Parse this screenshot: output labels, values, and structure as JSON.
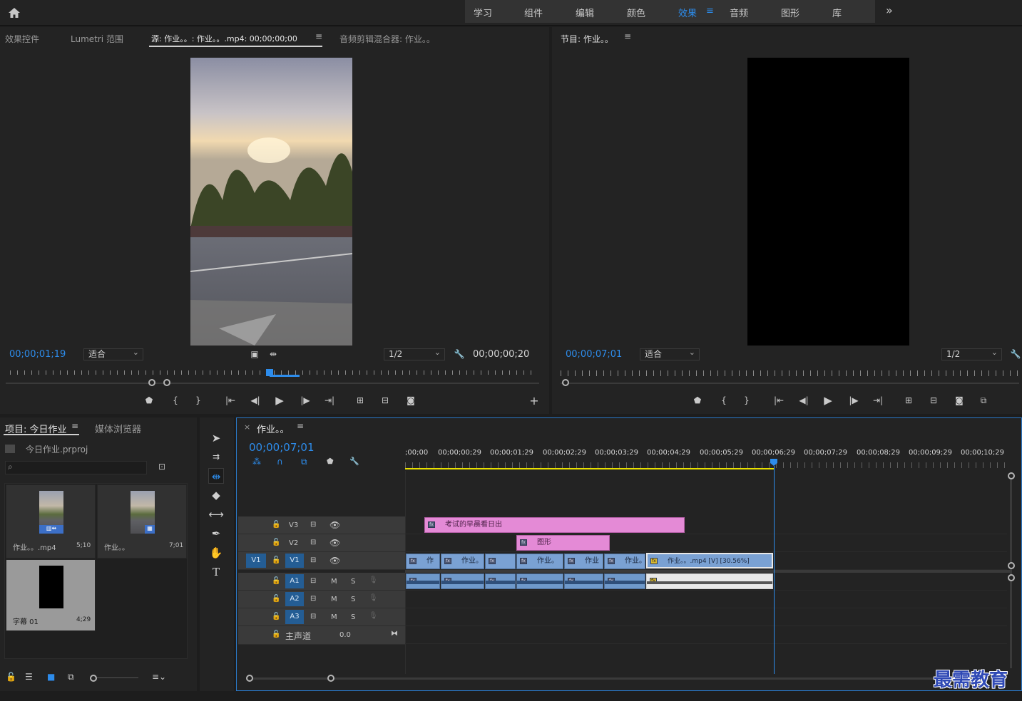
{
  "topbar": {
    "workspaces": [
      "学习",
      "组件",
      "编辑",
      "颜色",
      "效果",
      "音频",
      "图形",
      "库"
    ],
    "active": "效果",
    "more": "»"
  },
  "source": {
    "tabs": [
      "效果控件",
      "Lumetri 范围",
      "源: 作业。。: 作业。。.mp4: 00;00;00;00",
      "音频剪辑混合器: 作业。。"
    ],
    "timecode": "00;00;01;19",
    "fit": "适合",
    "resolution": "1/2",
    "duration": "00;00;00;20"
  },
  "program": {
    "title": "节目: 作业。。",
    "timecode": "00;00;07;01",
    "fit": "适合",
    "resolution": "1/2"
  },
  "project": {
    "tabs": [
      "项目: 今日作业",
      "媒体浏览器"
    ],
    "file": "今日作业.prproj",
    "items": [
      {
        "name": "作业。。.mp4",
        "dur": "5;10"
      },
      {
        "name": "作业。。",
        "dur": "7;01"
      },
      {
        "name": "字幕 01",
        "dur": "4;29"
      }
    ]
  },
  "timeline": {
    "title": "作业。。",
    "timecode": "00;00;07;01",
    "ruler": [
      ";00;00",
      "00;00;00;29",
      "00;00;01;29",
      "00;00;02;29",
      "00;00;03;29",
      "00;00;04;29",
      "00;00;05;29",
      "00;00;06;29",
      "00;00;07;29",
      "00;00;08;29",
      "00;00;09;29",
      "00;00;10;29"
    ],
    "tracks": {
      "v3": "V3",
      "v2": "V2",
      "v1": "V1",
      "v1src": "V1",
      "a1": "A1",
      "a2": "A2",
      "a3": "A3",
      "master": "主声道",
      "master_val": "0.0",
      "m": "M",
      "s": "S"
    },
    "clips": {
      "v3": "考试的早晨看日出",
      "v2": "图形",
      "v1": [
        "作",
        "作业。",
        "作业。",
        "作业",
        "作业。",
        "作业。。.mp4 [V] [30.56%]"
      ]
    }
  },
  "watermark": "最需教育",
  "colors": {
    "accent": "#2d8ceb",
    "pink": "#e48ad6",
    "clip": "#7aa1d3"
  }
}
